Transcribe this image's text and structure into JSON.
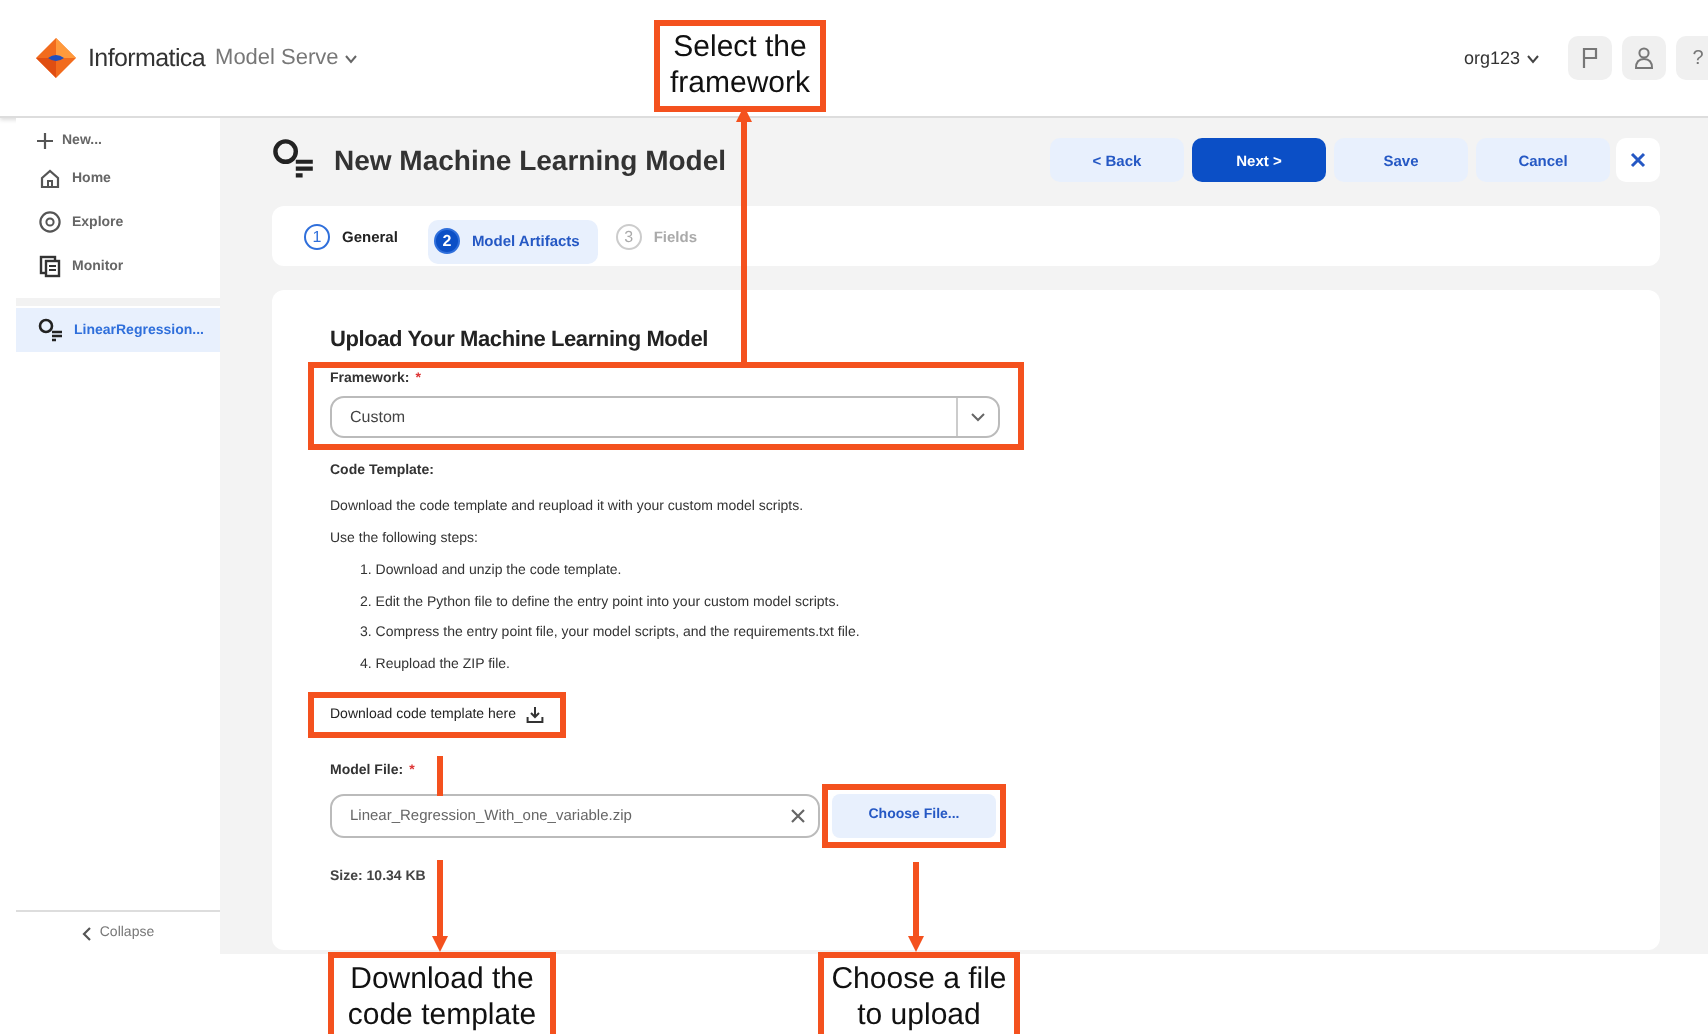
{
  "header": {
    "brand": "Informatica",
    "product": "Model Serve",
    "org": "org123",
    "help": "?"
  },
  "sidebar": {
    "new_label": "New...",
    "items": [
      {
        "label": "Home",
        "kind": "home",
        "selected": false
      },
      {
        "label": "Explore",
        "kind": "explore",
        "selected": false
      },
      {
        "label": "Monitor",
        "kind": "monitor",
        "selected": false
      }
    ],
    "recent": [
      {
        "label": "LinearRegression...",
        "selected": true
      }
    ],
    "collapse": "Collapse"
  },
  "page": {
    "title": "New Machine Learning Model",
    "buttons": [
      {
        "label": "< Back",
        "kind": "secondary"
      },
      {
        "label": "Next >",
        "kind": "primary"
      },
      {
        "label": "Save",
        "kind": "secondary"
      },
      {
        "label": "Cancel",
        "kind": "secondary"
      }
    ]
  },
  "steps": [
    {
      "number": "1",
      "label": "General",
      "selected": false,
      "disabled": false
    },
    {
      "number": "2",
      "label": "Model Artifacts",
      "selected": true,
      "disabled": false
    },
    {
      "number": "3",
      "label": "Fields",
      "selected": false,
      "disabled": true
    }
  ],
  "form": {
    "heading": "Upload Your Machine Learning Model",
    "framework": {
      "label": "Framework:",
      "required_mark": "*",
      "value": "Custom",
      "highlighted": true
    },
    "code_template": {
      "label": "Code Template:",
      "intro": "Download the code template and reupload it with your custom model scripts.",
      "steps_label": "Use the following steps:",
      "steps": [
        "1. Download and unzip the code template.",
        "2. Edit the Python file to define the entry point into your custom model scripts.",
        "3. Compress the entry point file, your model scripts, and the requirements.txt file.",
        "4. Reupload the ZIP file."
      ]
    },
    "download_link": {
      "label": "Download code template here",
      "highlighted": true
    },
    "model_file": {
      "label": "Model File:",
      "required_mark": "*",
      "value": "Linear_Regression_With_one_variable.zip",
      "button": "Choose File...",
      "button_highlighted": true
    },
    "size": "Size: 10.34 KB"
  },
  "callouts": [
    {
      "text": "Select the framework"
    },
    {
      "text": "Download the code template"
    },
    {
      "text": "Choose a file to upload"
    }
  ]
}
